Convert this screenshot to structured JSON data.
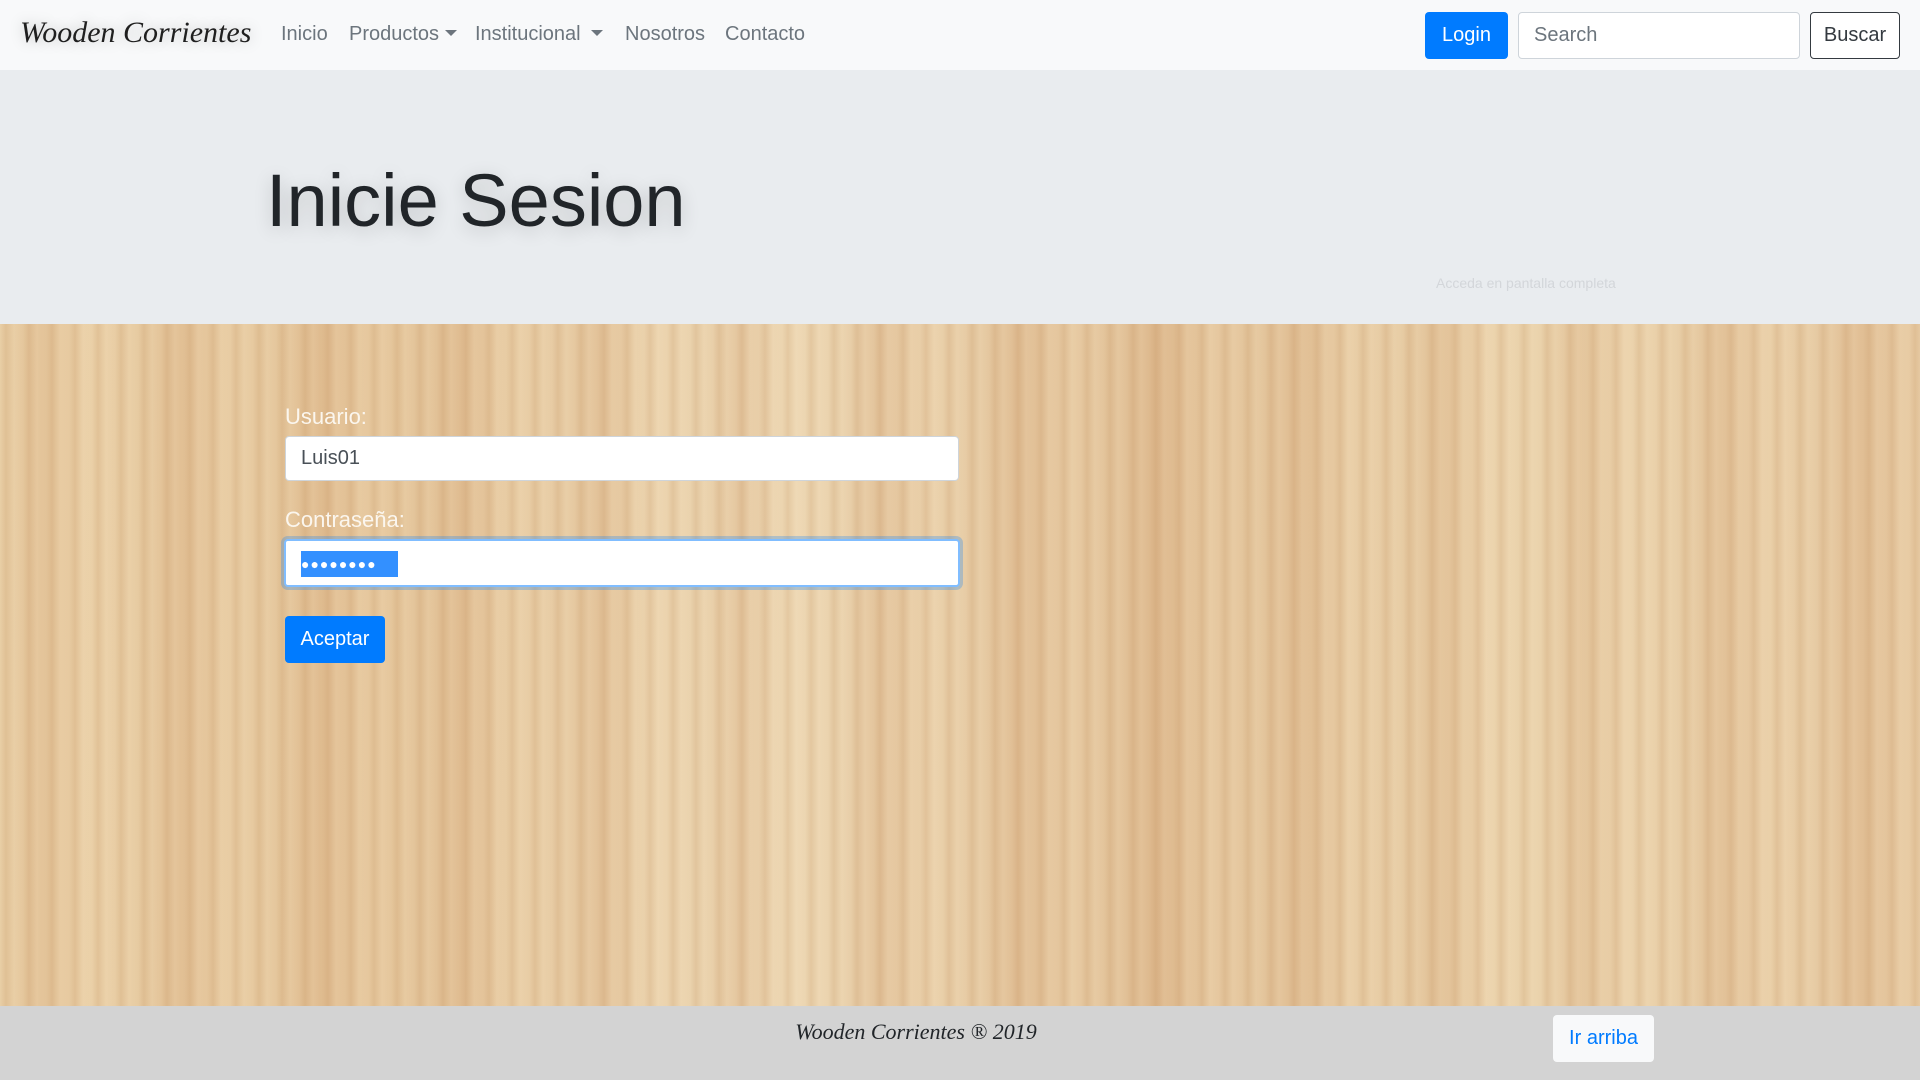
{
  "navbar": {
    "brand": "Wooden Corrientes",
    "links": [
      {
        "label": "Inicio",
        "dropdown": false
      },
      {
        "label": "Productos",
        "dropdown": true
      },
      {
        "label": "Institucional",
        "dropdown": true
      },
      {
        "label": "Nosotros",
        "dropdown": false
      },
      {
        "label": "Contacto",
        "dropdown": false
      }
    ],
    "login_label": "Login",
    "search_placeholder": "Search",
    "search_button": "Buscar"
  },
  "header": {
    "title": "Inicie Sesion",
    "fullscreen_hint": "Acceda en pantalla completa"
  },
  "form": {
    "user_label": "Usuario:",
    "user_value": "Luis01",
    "password_label": "Contraseña:",
    "password_masked": "●●●●●●●●",
    "submit_label": "Aceptar"
  },
  "footer": {
    "text": "Wooden Corrientes ® 2019",
    "top_button": "Ir arriba"
  },
  "colors": {
    "primary": "#007bff",
    "navbar_bg": "#f8f9fa",
    "jumbotron_bg": "#e9ecef",
    "footer_bg": "#d3d3d3"
  }
}
